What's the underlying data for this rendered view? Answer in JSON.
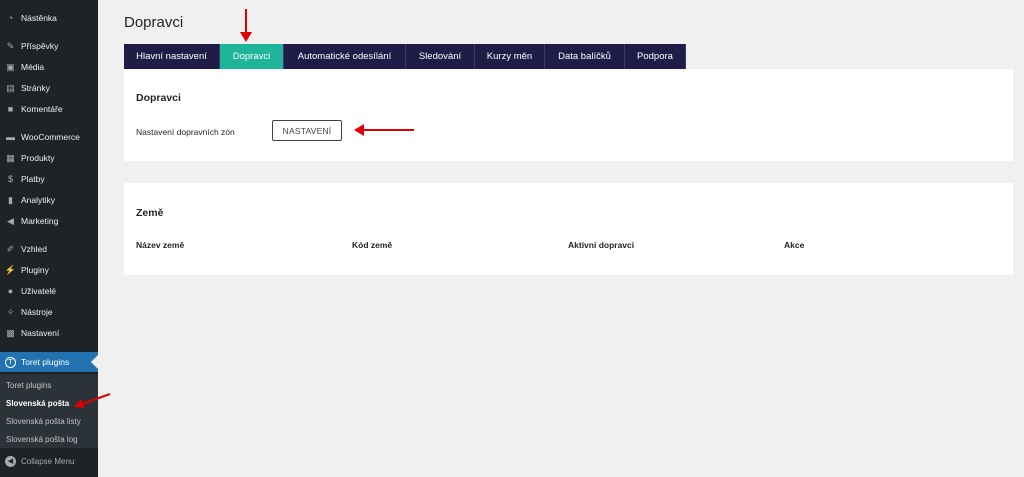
{
  "sidebar": {
    "items": [
      {
        "label": "Nástěnka",
        "icon": "dashboard-icon"
      },
      {
        "label": "Příspěvky",
        "icon": "pin-icon"
      },
      {
        "label": "Média",
        "icon": "media-icon"
      },
      {
        "label": "Stránky",
        "icon": "pages-icon"
      },
      {
        "label": "Komentáře",
        "icon": "comments-icon"
      },
      {
        "label": "WooCommerce",
        "icon": "woocommerce-icon"
      },
      {
        "label": "Produkty",
        "icon": "products-icon"
      },
      {
        "label": "Platby",
        "icon": "dollar-icon"
      },
      {
        "label": "Analytiky",
        "icon": "chart-bar-icon"
      },
      {
        "label": "Marketing",
        "icon": "megaphone-icon"
      },
      {
        "label": "Vzhled",
        "icon": "brush-icon"
      },
      {
        "label": "Pluginy",
        "icon": "plug-icon"
      },
      {
        "label": "Uživatelé",
        "icon": "user-icon"
      },
      {
        "label": "Nástroje",
        "icon": "wrench-icon"
      },
      {
        "label": "Nastavení",
        "icon": "settings-icon"
      },
      {
        "label": "Toret plugins",
        "icon": "toret-t-icon"
      }
    ],
    "submenu": [
      {
        "label": "Toret plugins"
      },
      {
        "label": "Slovenská pošta"
      },
      {
        "label": "Slovenská pošta listy"
      },
      {
        "label": "Slovenská pošta log"
      }
    ],
    "collapse_label": "Collapse Menu"
  },
  "page": {
    "title": "Dopravci",
    "tabs": [
      {
        "label": "Hlavní nastavení"
      },
      {
        "label": "Dopravci"
      },
      {
        "label": "Automatické odesílání"
      },
      {
        "label": "Sledování"
      },
      {
        "label": "Kurzy měn"
      },
      {
        "label": "Data balíčků"
      },
      {
        "label": "Podpora"
      }
    ],
    "carriers": {
      "title": "Dopravci",
      "zones_label": "Nastavení dopravních zón",
      "settings_button": "NASTAVENÍ"
    },
    "countries": {
      "title": "Země",
      "columns": [
        "Název země",
        "Kód země",
        "Aktivní dopravci",
        "Akce"
      ]
    }
  },
  "colors": {
    "sidebar_bg": "#1d2327",
    "menu_active": "#2271b1",
    "tab_bg": "#1f1d47",
    "tab_active": "#1fb59b",
    "annotation_arrow": "#e00000"
  }
}
